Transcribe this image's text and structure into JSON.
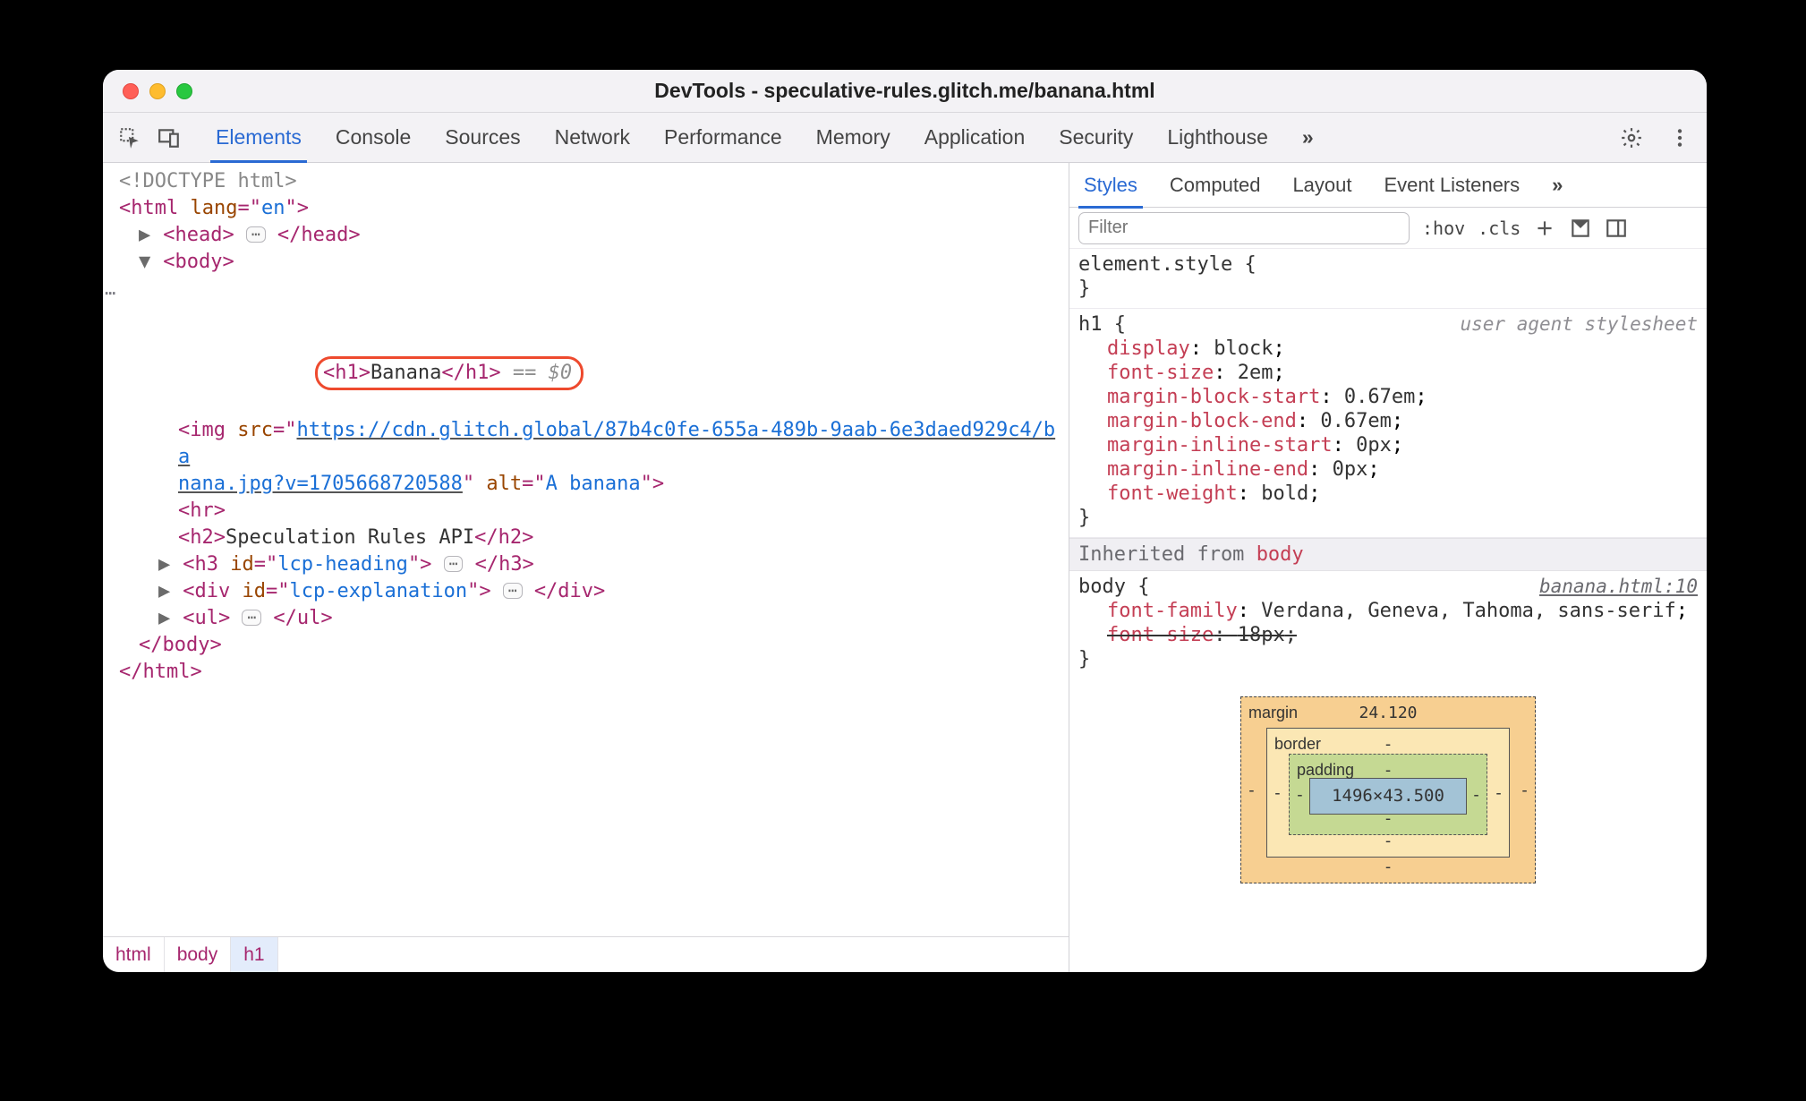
{
  "window": {
    "title": "DevTools - speculative-rules.glitch.me/banana.html"
  },
  "tabbar": {
    "tabs": [
      "Elements",
      "Console",
      "Sources",
      "Network",
      "Performance",
      "Memory",
      "Application",
      "Security",
      "Lighthouse"
    ],
    "active_index": 0,
    "overflow_glyph": "»"
  },
  "dom": {
    "doctype": "<!DOCTYPE html>",
    "html_open": "<html lang=\"en\">",
    "head_open": "<head>",
    "head_close": "</head>",
    "body_open": "<body>",
    "h1_open": "<h1>",
    "h1_text": "Banana",
    "h1_close": "</h1>",
    "h1_console_ref": " == $0",
    "img_prefix": "<img src=\"",
    "img_url_part1": "https://cdn.glitch.global/87b4c0fe-655a-489b-9aab-6e3daed929c4/ba",
    "img_url_part2": "nana.jpg?v=1705668720588",
    "img_suffix": "\" alt=\"A banana\">",
    "hr": "<hr>",
    "h2_open": "<h2>",
    "h2_text": "Speculation Rules API",
    "h2_close": "</h2>",
    "h3": "<h3 id=\"lcp-heading\">",
    "h3_close": "</h3>",
    "div": "<div id=\"lcp-explanation\">",
    "div_close": "</div>",
    "ul": "<ul>",
    "ul_close": "</ul>",
    "body_close": "</body>",
    "html_close": "</html>",
    "ellipsis": "⋯"
  },
  "crumbs": [
    "html",
    "body",
    "h1"
  ],
  "styles": {
    "tabs": [
      "Styles",
      "Computed",
      "Layout",
      "Event Listeners"
    ],
    "active_index": 0,
    "overflow_glyph": "»",
    "filter_placeholder": "Filter",
    "hov_label": "hov",
    "cls_label": "cls",
    "element_style": {
      "selector": "element.style",
      "open": "{",
      "close": "}"
    },
    "h1_rule": {
      "selector": "h1",
      "source": "user agent stylesheet",
      "props": [
        {
          "name": "display",
          "value": "block"
        },
        {
          "name": "font-size",
          "value": "2em"
        },
        {
          "name": "margin-block-start",
          "value": "0.67em"
        },
        {
          "name": "margin-block-end",
          "value": "0.67em"
        },
        {
          "name": "margin-inline-start",
          "value": "0px"
        },
        {
          "name": "margin-inline-end",
          "value": "0px"
        },
        {
          "name": "font-weight",
          "value": "bold"
        }
      ]
    },
    "inherited_label": "Inherited from ",
    "inherited_from": "body",
    "body_rule": {
      "selector": "body",
      "source": "banana.html:10",
      "props": [
        {
          "name": "font-family",
          "value": "Verdana, Geneva, Tahoma, sans-serif",
          "strike": false
        },
        {
          "name": "font-size",
          "value": "18px",
          "strike": true
        }
      ]
    }
  },
  "boxmodel": {
    "margin": {
      "label": "margin",
      "top": "24.120",
      "right": "-",
      "bottom": "-",
      "left": "-"
    },
    "border": {
      "label": "border",
      "top": "-",
      "right": "-",
      "bottom": "-",
      "left": "-"
    },
    "padding": {
      "label": "padding",
      "top": "-",
      "right": "-",
      "bottom": "-",
      "left": "-"
    },
    "content": "1496×43.500"
  }
}
